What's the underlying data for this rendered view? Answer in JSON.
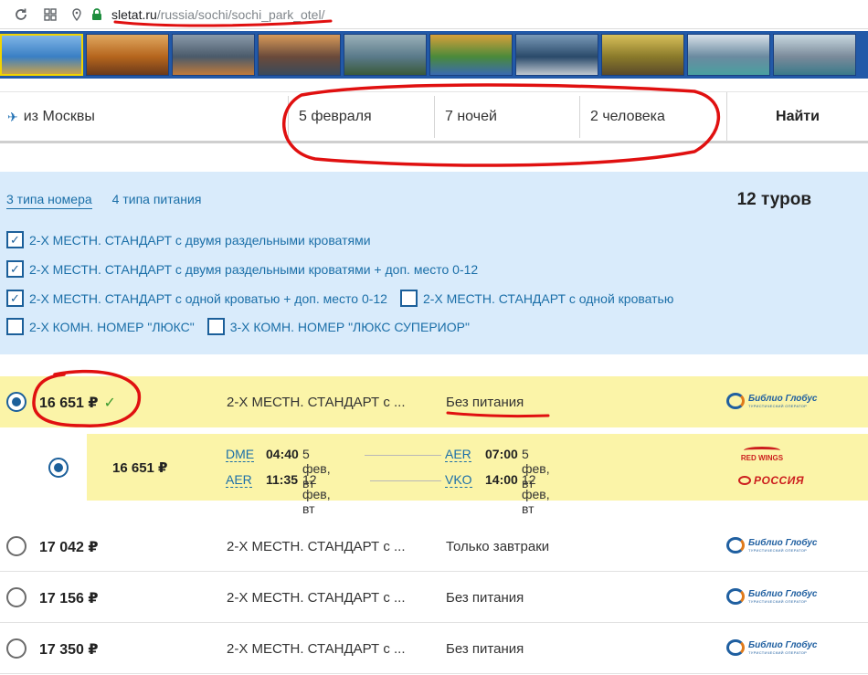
{
  "browser": {
    "url_domain": "sletat.ru",
    "url_path": "/russia/sochi/sochi_park_otel/"
  },
  "photos": [
    "hotel-pool",
    "lobby-reception",
    "lakefront-night",
    "resort-sunset",
    "resort-aerial",
    "playground",
    "lobby-interior",
    "room-yellow",
    "room-twin-beds",
    "room-view"
  ],
  "search": {
    "from": "из Москвы",
    "date": "5 февраля",
    "nights": "7 ночей",
    "people": "2 человека",
    "find_label": "Найти"
  },
  "filter": {
    "tabs": [
      "3 типа номера",
      "4 типа питания"
    ],
    "tours_count": "12 туров",
    "options": [
      {
        "label": "2-Х МЕСТН. СТАНДАРТ с двумя раздельными кроватями",
        "checked": true
      },
      {
        "label": "2-Х МЕСТН. СТАНДАРТ с двумя раздельными кроватями + доп. место 0-12",
        "checked": true
      },
      {
        "label": "2-Х МЕСТН. СТАНДАРТ с одной кроватью + доп. место 0-12",
        "checked": true
      },
      {
        "label": "2-Х МЕСТН. СТАНДАРТ с одной кроватью",
        "checked": false
      },
      {
        "label": "2-Х КОМН. НОМЕР \"ЛЮКС\"",
        "checked": false
      },
      {
        "label": "3-Х КОМН. НОМЕР \"ЛЮКС СУПЕРИОР\"",
        "checked": false
      }
    ]
  },
  "operator": {
    "name": "Библио Глобус",
    "sub": "ТУРИСТИЧЕСКИЙ ОПЕРАТОР"
  },
  "results": [
    {
      "price": "16 651 ₽",
      "room": "2-Х МЕСТН. СТАНДАРТ с ...",
      "meal": "Без питания",
      "selected": true
    },
    {
      "price": "17 042 ₽",
      "room": "2-Х МЕСТН. СТАНДАРТ с ...",
      "meal": "Только завтраки",
      "selected": false
    },
    {
      "price": "17 156 ₽",
      "room": "2-Х МЕСТН. СТАНДАРТ с ...",
      "meal": "Без питания",
      "selected": false
    },
    {
      "price": "17 350 ₽",
      "room": "2-Х МЕСТН. СТАНДАРТ с ...",
      "meal": "Без питания",
      "selected": false
    }
  ],
  "flights": {
    "price": "16 651 ₽",
    "outbound": {
      "from": "DME",
      "dep_time": "04:40",
      "dep_date": "5 фев, вт",
      "to": "AER",
      "arr_time": "07:00",
      "arr_date": "5 фев, вт"
    },
    "inbound": {
      "from": "AER",
      "dep_time": "11:35",
      "dep_date": "12 фев, вт",
      "to": "VKO",
      "arr_time": "14:00",
      "arr_date": "12 фев, вт"
    },
    "airline1": "RED WINGS",
    "airline2": "РОССИЯ"
  },
  "colors": {
    "accent_blue": "#1b6fa8",
    "filter_bg": "#d9ebfb",
    "selected_bg": "#fbf4a8",
    "annotation_red": "#e01010"
  }
}
